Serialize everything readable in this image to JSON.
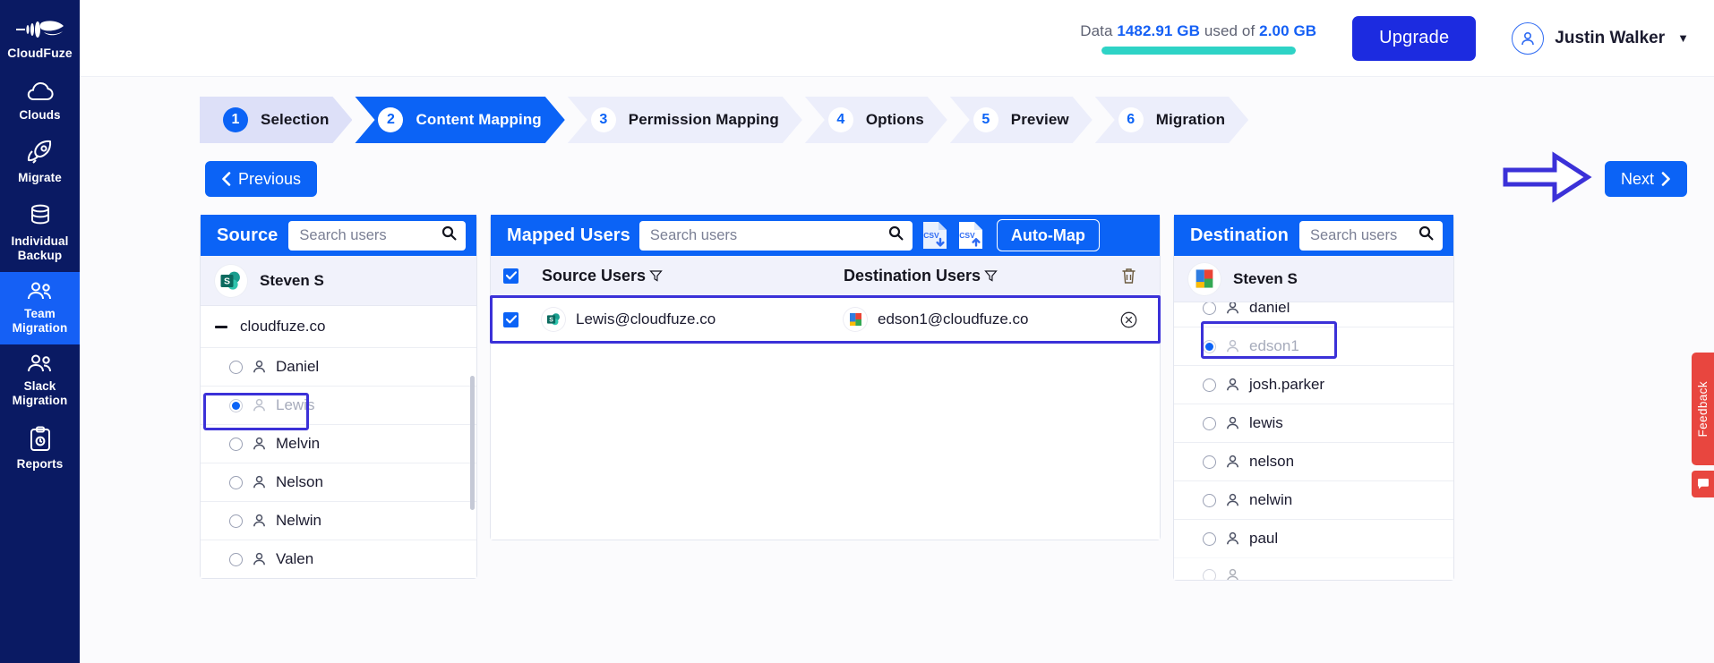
{
  "sidebar": {
    "items": [
      {
        "id": "logo",
        "label": "CloudFuze",
        "icon": "cloudfuze-logo-icon"
      },
      {
        "id": "clouds",
        "label": "Clouds",
        "icon": "cloud-icon"
      },
      {
        "id": "migrate",
        "label": "Migrate",
        "icon": "rocket-icon"
      },
      {
        "id": "individual-backup",
        "label": "Individual\nBackup",
        "icon": "database-icon"
      },
      {
        "id": "team-migration",
        "label": "Team\nMigration",
        "icon": "users-icon"
      },
      {
        "id": "slack-migration",
        "label": "Slack\nMigration",
        "icon": "users-icon"
      },
      {
        "id": "reports",
        "label": "Reports",
        "icon": "clipboard-icon"
      }
    ],
    "active": "team-migration"
  },
  "header": {
    "usage_prefix": "Data",
    "usage_used": "1482.91 GB",
    "usage_middle": "used of",
    "usage_total": "2.00 GB",
    "usage_percent": 100,
    "upgrade_label": "Upgrade",
    "user_name": "Justin Walker"
  },
  "stepper": {
    "steps": [
      {
        "num": "1",
        "label": "Selection"
      },
      {
        "num": "2",
        "label": "Content Mapping"
      },
      {
        "num": "3",
        "label": "Permission Mapping"
      },
      {
        "num": "4",
        "label": "Options"
      },
      {
        "num": "5",
        "label": "Preview"
      },
      {
        "num": "6",
        "label": "Migration"
      }
    ],
    "active_index": 1
  },
  "nav": {
    "previous_label": "Previous",
    "next_label": "Next"
  },
  "source_panel": {
    "title": "Source",
    "search_placeholder": "Search users",
    "search_value": "",
    "account_name": "Steven S",
    "account_icon": "sharepoint-icon",
    "root_label": "cloudfuze.co",
    "users": [
      {
        "name": "Daniel",
        "selected": false,
        "dimmed": false
      },
      {
        "name": "Lewis",
        "selected": true,
        "dimmed": true
      },
      {
        "name": "Melvin",
        "selected": false,
        "dimmed": false
      },
      {
        "name": "Nelson",
        "selected": false,
        "dimmed": false
      },
      {
        "name": "Nelwin",
        "selected": false,
        "dimmed": false
      },
      {
        "name": "Valen",
        "selected": false,
        "dimmed": false
      }
    ]
  },
  "mapped_panel": {
    "title": "Mapped Users",
    "search_placeholder": "Search users",
    "search_value": "",
    "csv_download_icon": "csv-download-icon",
    "csv_upload_icon": "csv-upload-icon",
    "automap_label": "Auto-Map",
    "columns": {
      "source": "Source Users",
      "destination": "Destination Users",
      "delete_icon": "trash-icon"
    },
    "header_checked": true,
    "rows": [
      {
        "checked": true,
        "source_user": "Lewis@cloudfuze.co",
        "source_icon": "sharepoint-icon",
        "destination_user": "edson1@cloudfuze.co",
        "destination_icon": "google-drive-icon",
        "remove_icon": "circle-x-icon"
      }
    ]
  },
  "destination_panel": {
    "title": "Destination",
    "search_placeholder": "Search users",
    "search_value": "",
    "account_name": "Steven S",
    "account_icon": "google-drive-icon",
    "users": [
      {
        "name": "daniel",
        "selected": false,
        "dimmed": false,
        "partial": true
      },
      {
        "name": "edson1",
        "selected": true,
        "dimmed": true
      },
      {
        "name": "josh.parker",
        "selected": false,
        "dimmed": false
      },
      {
        "name": "lewis",
        "selected": false,
        "dimmed": false
      },
      {
        "name": "nelson",
        "selected": false,
        "dimmed": false
      },
      {
        "name": "nelwin",
        "selected": false,
        "dimmed": false
      },
      {
        "name": "paul",
        "selected": false,
        "dimmed": false
      }
    ]
  },
  "feedback": {
    "label": "Feedback",
    "chat_icon": "chat-icon"
  },
  "colors": {
    "accent": "#0b63f6",
    "sidebar": "#0a1a63",
    "upgrade": "#1c2be0",
    "usage_bar": "#2ed3c6",
    "annotation": "#3b31d8",
    "feedback": "#e8463f"
  }
}
